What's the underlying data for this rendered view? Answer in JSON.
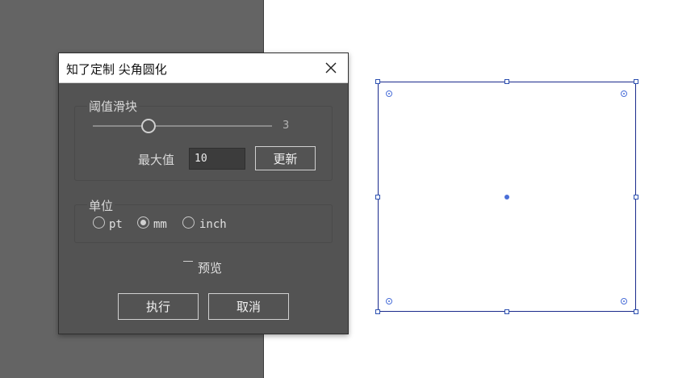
{
  "dialog": {
    "title": "知了定制 尖角圆化",
    "threshold_group": {
      "label": "阈值滑块",
      "slider_value": "3",
      "slider_fraction": 0.3,
      "max_label": "最大值",
      "max_value": "10",
      "update_button": "更新"
    },
    "unit_group": {
      "label": "单位",
      "options": [
        {
          "label": "pt",
          "checked": false
        },
        {
          "label": "mm",
          "checked": true
        },
        {
          "label": "inch",
          "checked": false
        }
      ]
    },
    "preview_label": "预览",
    "preview_checked": false,
    "execute_button": "执行",
    "cancel_button": "取消"
  },
  "colors": {
    "dialog_bg": "#535353",
    "left_panel_bg": "#646464",
    "selection_stroke": "#1a2a8c",
    "widget_blue": "#4a6fd8"
  }
}
